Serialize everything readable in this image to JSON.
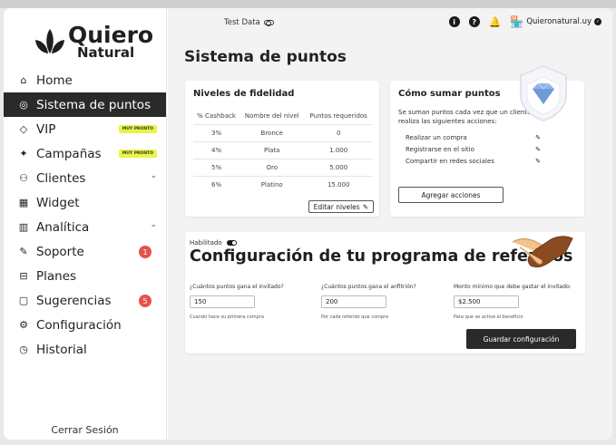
{
  "app": {
    "logo_line1": "Quiero",
    "logo_line2": "Natural",
    "test_data_label": "Test Data",
    "store_name": "Quieronatural.uy"
  },
  "sidebar": {
    "items": [
      {
        "label": "Home",
        "icon": "home-icon"
      },
      {
        "label": "Sistema de puntos",
        "icon": "points-icon",
        "active": true
      },
      {
        "label": "VIP",
        "icon": "diamond-icon",
        "badge": "MUY PRONTO"
      },
      {
        "label": "Campañas",
        "icon": "sparkle-icon",
        "badge": "MUY PRONTO"
      },
      {
        "label": "Clientes",
        "icon": "users-icon"
      },
      {
        "label": "Widget",
        "icon": "grid-icon"
      },
      {
        "label": "Analítica",
        "icon": "chart-icon"
      },
      {
        "label": "Soporte",
        "icon": "pen-icon",
        "count": "1"
      },
      {
        "label": "Planes",
        "icon": "box-icon"
      },
      {
        "label": "Sugerencias",
        "icon": "chat-icon",
        "count": "5"
      },
      {
        "label": "Configuración",
        "icon": "gear-icon"
      },
      {
        "label": "Historial",
        "icon": "history-icon"
      }
    ],
    "logout": "Cerrar Sesión"
  },
  "page": {
    "title": "Sistema de puntos"
  },
  "fidelidad": {
    "title": "Niveles de fidelidad",
    "headers": [
      "% Cashback",
      "Nombre del nivel",
      "Puntos requeridos"
    ],
    "rows": [
      [
        "3%",
        "Bronce",
        "0"
      ],
      [
        "4%",
        "Plata",
        "1.000"
      ],
      [
        "5%",
        "Oro",
        "5.000"
      ],
      [
        "6%",
        "Platino",
        "15.000"
      ]
    ],
    "edit_label": "Editar niveles"
  },
  "sumar": {
    "title": "Cómo sumar puntos",
    "subtitle": "Se suman puntos cada vez que un cliente realiza las siguientes acciones:",
    "actions": [
      "Realizar un compra",
      "Registrarse en el sitio",
      "Compartir en redes sociales"
    ],
    "add_label": "Agregar acciones"
  },
  "referidos": {
    "enabled_label": "Habilitado",
    "title": "Configuración de tu programa de referidos",
    "fields": [
      {
        "label": "¿Cuántos puntos gana el invitado?",
        "value": "150",
        "help": "Cuando hace su primera compra"
      },
      {
        "label": "¿Cuántos puntos gana el anfitrión?",
        "value": "200",
        "help": "Por cada referido que compre"
      },
      {
        "label": "Monto mínimo que debe gastar el invitado:",
        "value": "$2.500",
        "help": "Para que se active el beneficio"
      }
    ],
    "save_label": "Guardar configuración"
  },
  "colors": {
    "active_bg": "#2a2a2a",
    "badge_soon": "#e9f545",
    "count_badge": "#e5534b",
    "gem": "#8fb3e6"
  }
}
